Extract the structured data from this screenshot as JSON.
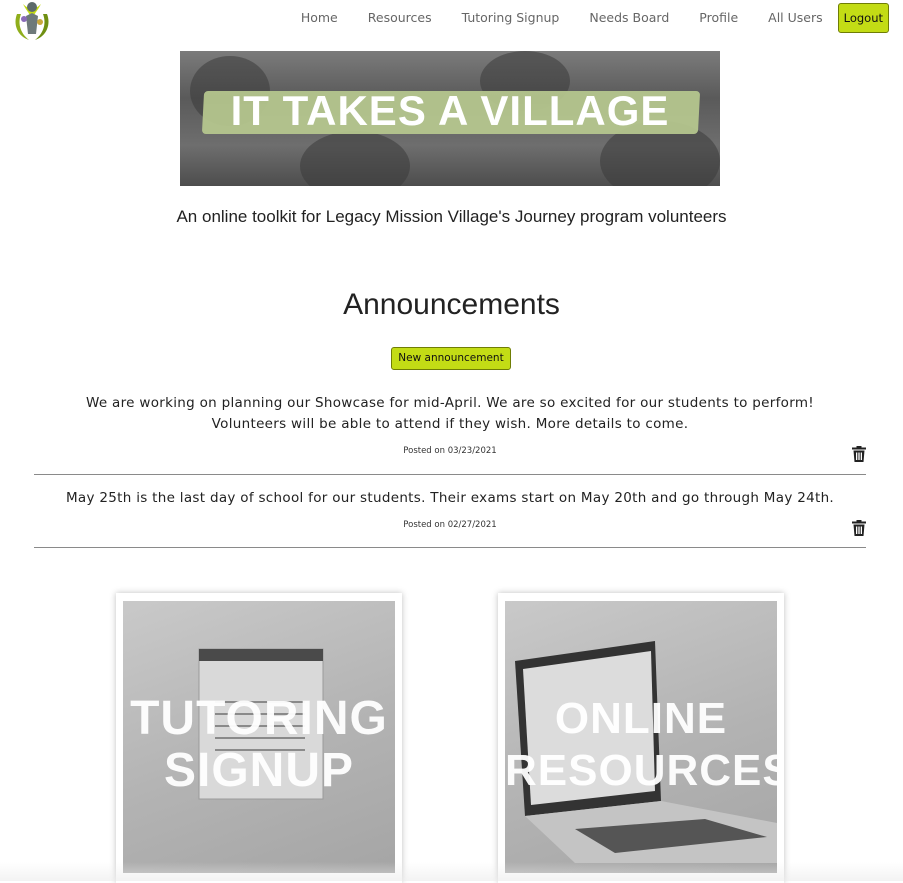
{
  "nav": {
    "logo_icon": "village-logo-icon",
    "links": [
      "Home",
      "Resources",
      "Tutoring Signup",
      "Needs Board",
      "Profile",
      "All Users"
    ],
    "logout_label": "Logout",
    "accent": "#c3dc15"
  },
  "hero": {
    "banner_text": "IT TAKES A VILLAGE",
    "tagline": "An online toolkit for Legacy Mission Village's Journey program volunteers"
  },
  "announcements": {
    "title": "Announcements",
    "new_label": "New announcement",
    "delete_icon": "trash-icon",
    "items": [
      {
        "text_line1": "We are working on planning our Showcase for mid-April. We are so excited for our students to perform!",
        "text_line2": "Volunteers will be able to attend if they wish. More details to come.",
        "posted": "Posted on 03/23/2021"
      },
      {
        "text_line1": "May 25th is the last day of school for our students. Their exams start on May 20th and go through May 24th.",
        "posted": "Posted on 02/27/2021"
      }
    ]
  },
  "cards": [
    {
      "line1": "TUTORING",
      "line2": "SIGNUP",
      "icon": "calendar-photo"
    },
    {
      "line1": "ONLINE",
      "line2": "RESOURCES",
      "icon": "laptop-photo"
    }
  ]
}
